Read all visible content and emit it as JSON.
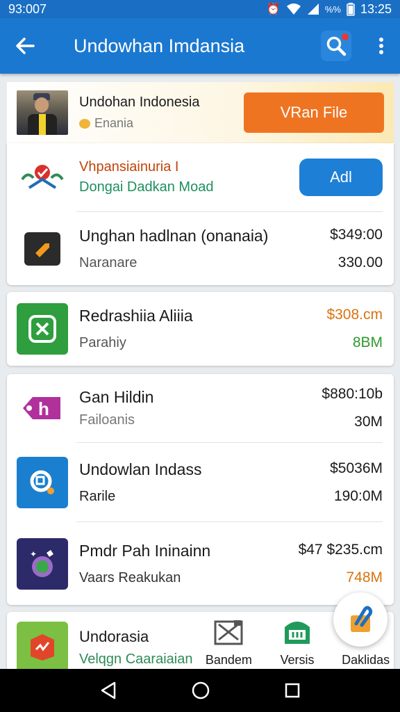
{
  "status": {
    "time_left": "93:007",
    "battery_pct": "%%",
    "time_right": "13:25"
  },
  "app_bar": {
    "title": "Undowhan Imdansia"
  },
  "banner": {
    "title": "Undohan Indonesia",
    "subtitle": "Enania",
    "button": "VRan File"
  },
  "ad": {
    "title": "Vhpansiainuria I",
    "subtitle": "Dongai Dadkan Moad",
    "button": "Adl"
  },
  "apps": [
    {
      "name": "Unghan hadlnan (onanaia)",
      "sub": "Naranare",
      "price": "$349:00",
      "size": "330.00"
    },
    {
      "name": "Redrashiia Aliiia",
      "sub": "Parahiy",
      "price": "$308.cm",
      "size": "8BM"
    },
    {
      "name": "Gan Hildin",
      "sub": "Failoanis",
      "price": "$880:10b",
      "size": "30M"
    },
    {
      "name": "Undowlan Indass",
      "sub": "Rarile",
      "price": "$5036M",
      "size": "190:0M"
    },
    {
      "name": "Pmdr Pah Ininainn",
      "sub": "Vaars Reakukan",
      "price": "$47 $235.cm",
      "size": "748M"
    },
    {
      "name": "Undorasia",
      "sub": "Velqgn Caaraiaian"
    }
  ],
  "tabs": [
    {
      "label": "Bandem"
    },
    {
      "label": "Versis"
    },
    {
      "label": "Daklidas"
    }
  ],
  "colors": {
    "primary": "#1b78d0",
    "accent": "#ef7422",
    "price_orange": "#d9730f",
    "size_green": "#2e9b2e"
  }
}
